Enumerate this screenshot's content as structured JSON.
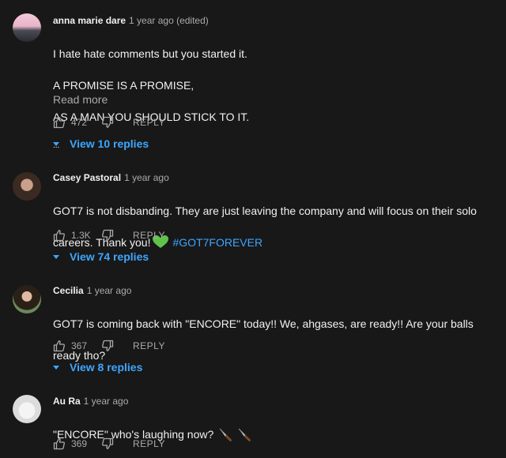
{
  "comments": [
    {
      "author": "anna marie dare",
      "time": "1 year ago (edited)",
      "lines": [
        "I hate hate comments but you started it.",
        "A PROMISE IS A PROMISE,",
        "AS A MAN YOU SHOULD STICK TO IT.",
        "..."
      ],
      "read_more": "Read more",
      "likes": "472",
      "reply_label": "REPLY",
      "view_replies": "View 10 replies"
    },
    {
      "author": "Casey Pastoral",
      "time": "1 year ago",
      "text1": "GOT7 is not disbanding. They are just leaving the company and will focus on their solo",
      "text2": "careers. Thank you!",
      "hashtag": "#GOT7FOREVER",
      "likes": "1.3K",
      "reply_label": "REPLY",
      "view_replies": "View 74 replies"
    },
    {
      "author": "Cecilia",
      "time": "1 year ago",
      "lines": [
        "GOT7 is coming back with \"ENCORE\" today!! We, ahgases, are ready!! Are your balls",
        "ready tho?"
      ],
      "likes": "367",
      "reply_label": "REPLY",
      "view_replies": "View 8 replies"
    },
    {
      "author": "Au Ra",
      "time": "1 year ago",
      "text": "\"ENCORE\" who's laughing now?",
      "likes": "369",
      "reply_label": "REPLY"
    }
  ],
  "colors": {
    "background": "#181818",
    "text": "#f1f1f1",
    "secondary": "#aaaaaa",
    "link": "#3ea6ff",
    "heart": "#5ec24b"
  },
  "icons": [
    "thumbs-up-icon",
    "thumbs-down-icon",
    "caret-down-icon",
    "green-heart-icon",
    "knife-icon"
  ]
}
